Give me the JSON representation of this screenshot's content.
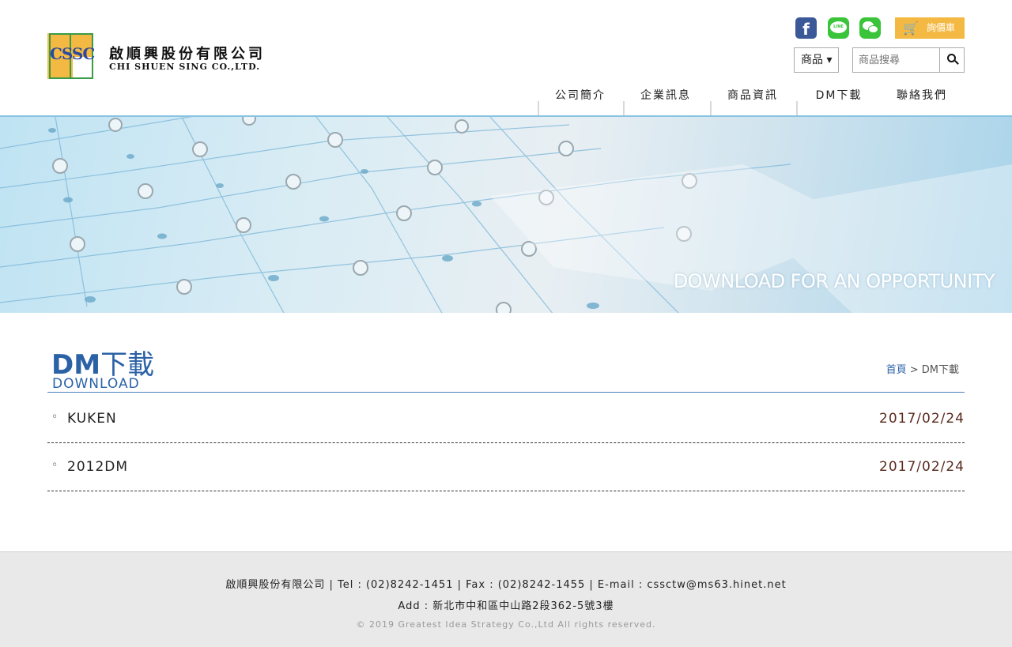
{
  "brand": {
    "logo_mark": "CSSC",
    "name_cn": "啟順興股份有限公司",
    "name_en": "CHI SHUEN SING CO.,LTD."
  },
  "header": {
    "social": [
      {
        "icon": "facebook-icon",
        "glyph": "f"
      },
      {
        "icon": "line-icon",
        "glyph": "LINE"
      },
      {
        "icon": "wechat-icon"
      }
    ],
    "cart_label": "詢價車",
    "category_select": "商品 ▾",
    "search_placeholder": "商品搜尋",
    "nav": [
      "公司簡介",
      "企業訊息",
      "商品資訊",
      "DM下載",
      "聯絡我們"
    ]
  },
  "banner": {
    "tagline": "DOWNLOAD FOR AN OPPORTUNITY"
  },
  "content": {
    "title_bold": "DM",
    "title_rest": "下載",
    "subtitle": "DOWNLOAD",
    "breadcrumb_home": "首頁",
    "breadcrumb_sep": " > ",
    "breadcrumb_current": "DM下載",
    "items": [
      {
        "bullet": "◦",
        "title": "KUKEN",
        "date": "2017/02/24"
      },
      {
        "bullet": "◦",
        "title": "2012DM",
        "date": "2017/02/24"
      }
    ]
  },
  "footer": {
    "line1": "啟順興股份有限公司 | Tel : (02)8242-1451 | Fax : (02)8242-1455 | E-mail : cssctw@ms63.hinet.net",
    "line2": "Add : 新北市中和區中山路2段362-5號3樓",
    "copyright": "© 2019 Greatest Idea Strategy Co.,Ltd All rights reserved."
  },
  "colors": {
    "accent_blue": "#2b62a6",
    "cart_yellow": "#f4b942",
    "facebook": "#3b5998",
    "line_green": "#3ac43a",
    "date_brown": "#5a2a1e"
  }
}
